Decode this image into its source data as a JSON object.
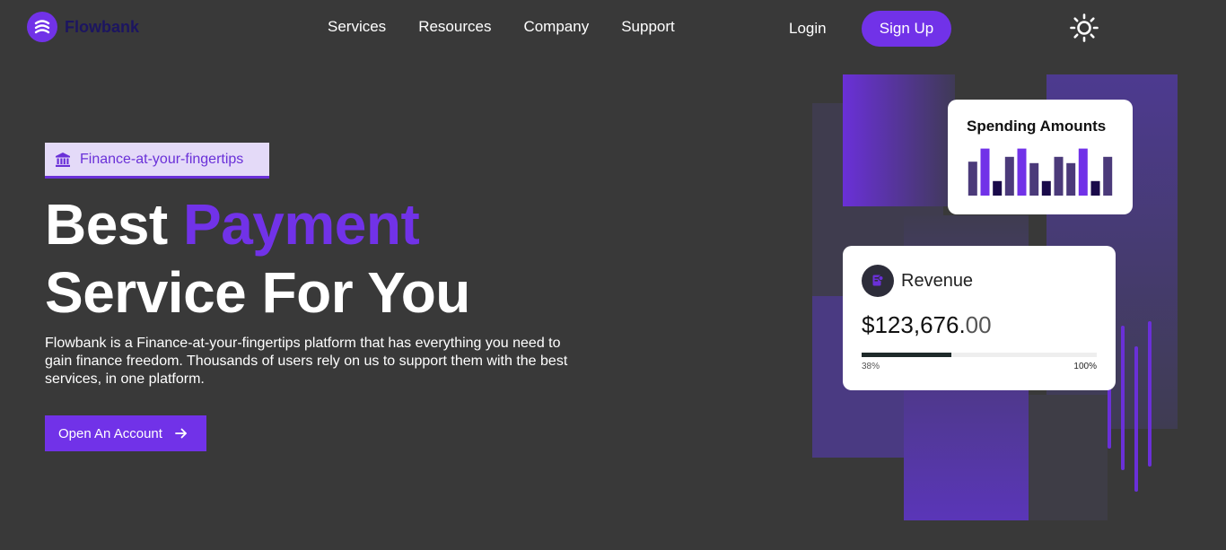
{
  "brand": {
    "name": "Flowbank",
    "accent": "#7132e8",
    "logo_icon": "wave-logo-icon"
  },
  "nav": {
    "links": [
      "Services",
      "Resources",
      "Company",
      "Support"
    ],
    "login_label": "Login",
    "signup_label": "Sign Up",
    "theme_icon": "sun-icon"
  },
  "hero": {
    "badge": {
      "icon": "bank-icon",
      "text": "Finance-at-your-fingertips"
    },
    "headline": {
      "line1_plain": "Best ",
      "line1_accent": "Payment",
      "line2": "Service For You"
    },
    "description": "Flowbank is a Finance-at-your-fingertips platform that has everything you need to gain finance freedom. Thousands of users rely on us to support them with the best services, in one platform.",
    "cta_label": "Open An Account",
    "cta_icon": "arrow-right-icon"
  },
  "spending_card": {
    "title": "Spending Amounts",
    "bars": [
      0.7,
      0.97,
      0.3,
      0.8,
      0.97,
      0.67,
      0.3,
      0.8,
      0.67,
      0.97,
      0.3,
      0.8
    ],
    "bar_colors": [
      "#4b3a7a",
      "#7132e8",
      "#1a0a4a"
    ]
  },
  "revenue_card": {
    "icon": "receipt-icon",
    "title": "Revenue",
    "amount_main": "$123,676.",
    "amount_cents": "00",
    "progress_fraction": 0.38,
    "progress_min_label": "38%",
    "progress_max_label": "100%"
  }
}
